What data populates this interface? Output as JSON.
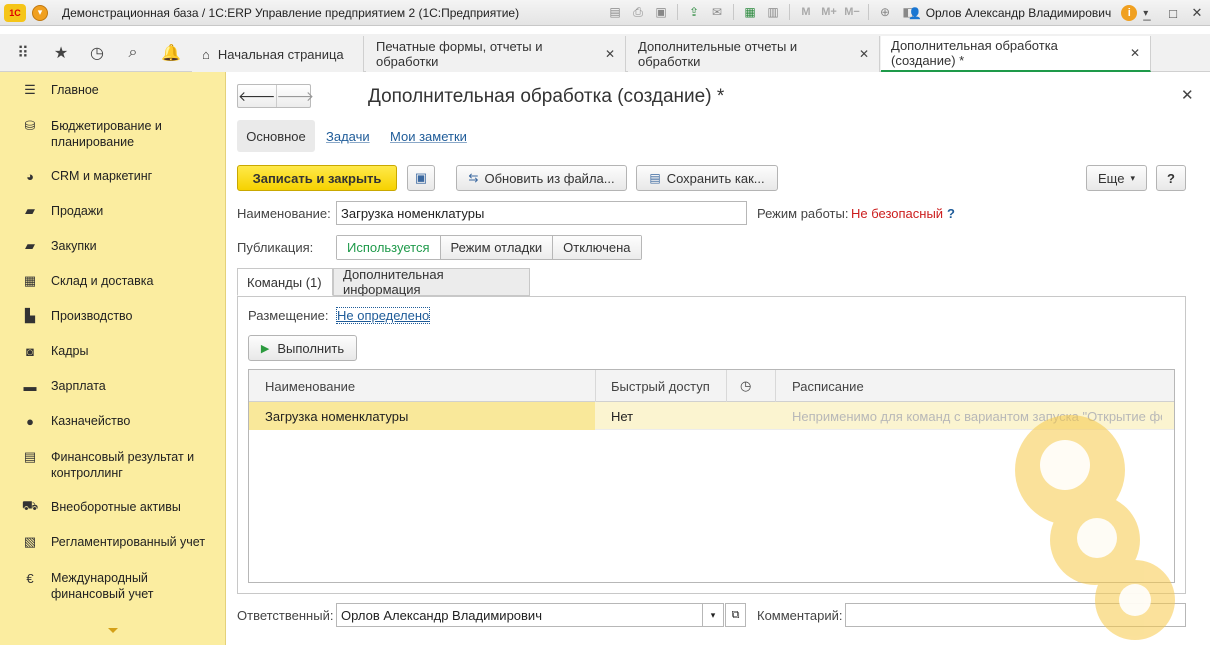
{
  "window": {
    "logo_text": "1С",
    "title": "Демонстрационная база / 1С:ERP Управление предприятием 2  (1С:Предприятие)",
    "user_name": "Орлов Александр Владимирович",
    "toolbar_icons": [
      "save-icon",
      "print-icon",
      "preview-icon",
      "upload-icon",
      "mail-icon",
      "calculator-icon",
      "calendar-icon",
      "m-icon",
      "m-plus-icon",
      "m-minus-icon",
      "zoom-icon",
      "panel-icon"
    ],
    "tb_letters": {
      "m": "M",
      "mplus": "M+",
      "mminus": "M−"
    }
  },
  "tabs": [
    {
      "label": "Начальная страница",
      "closable": false
    },
    {
      "label": "Печатные формы, отчеты и обработки",
      "closable": true
    },
    {
      "label": "Дополнительные отчеты и обработки",
      "closable": true
    },
    {
      "label": "Дополнительная обработка (создание) *",
      "closable": true,
      "active": true
    }
  ],
  "sidebar": {
    "items": [
      {
        "label": "Главное",
        "icon": "menu-icon"
      },
      {
        "label": "Бюджетирование и планирование",
        "icon": "budget-icon"
      },
      {
        "label": "CRM и маркетинг",
        "icon": "crm-icon"
      },
      {
        "label": "Продажи",
        "icon": "sales-icon"
      },
      {
        "label": "Закупки",
        "icon": "purchases-icon"
      },
      {
        "label": "Склад и доставка",
        "icon": "warehouse-icon"
      },
      {
        "label": "Производство",
        "icon": "factory-icon"
      },
      {
        "label": "Кадры",
        "icon": "staff-icon"
      },
      {
        "label": "Зарплата",
        "icon": "salary-icon"
      },
      {
        "label": "Казначейство",
        "icon": "treasury-icon"
      },
      {
        "label": "Финансовый результат и контроллинг",
        "icon": "finance-icon"
      },
      {
        "label": "Внеоборотные активы",
        "icon": "assets-icon"
      },
      {
        "label": "Регламентированный учет",
        "icon": "regulated-icon"
      },
      {
        "label": "Международный финансовый учет",
        "icon": "international-icon"
      }
    ]
  },
  "form": {
    "title": "Дополнительная обработка (создание) *",
    "subnav": {
      "main": "Основное",
      "tasks": "Задачи",
      "notes": "Мои заметки"
    },
    "buttons": {
      "save_close": "Записать и закрыть",
      "update_from_file": "Обновить из файла...",
      "save_as": "Сохранить как...",
      "more": "Еще",
      "help": "?",
      "execute": "Выполнить"
    },
    "name_label": "Наименование:",
    "name_value": "Загрузка номенклатуры",
    "mode_label": "Режим работы:",
    "mode_value": "Не безопасный",
    "mode_help": "?",
    "publication_label": "Публикация:",
    "publication_options": [
      "Используется",
      "Режим отладки",
      "Отключена"
    ],
    "publication_selected": 0,
    "inner_tabs": [
      "Команды (1)",
      "Дополнительная информация"
    ],
    "placement_label": "Размещение:",
    "placement_value": "Не определено",
    "table": {
      "columns": [
        "Наименование",
        "Быстрый доступ",
        "",
        "Расписание"
      ],
      "rows": [
        {
          "name": "Загрузка номенклатуры",
          "quick_access": "Нет",
          "schedule": "Неприменимо для команд с вариантом запуска \"Открытие формы\""
        }
      ]
    },
    "responsible_label": "Ответственный:",
    "responsible_value": "Орлов Александр Владимирович",
    "comment_label": "Комментарий:",
    "comment_value": ""
  },
  "colors": {
    "sidebar_bg": "#fbeda0",
    "primary_button": "#f6d200",
    "active_tab_underline": "#1e9a4a",
    "link": "#1f5c99",
    "warning_text": "#cc1e1e"
  }
}
